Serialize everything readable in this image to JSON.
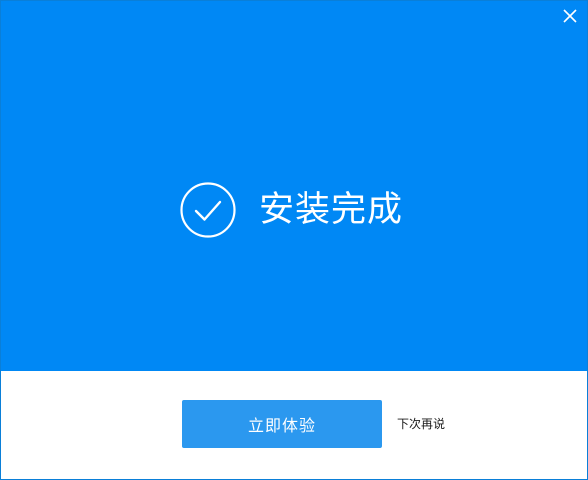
{
  "window": {
    "close_icon": "close-icon"
  },
  "status": {
    "icon": "check-circle-icon",
    "text": "安装完成"
  },
  "actions": {
    "primary_label": "立即体验",
    "secondary_label": "下次再说"
  },
  "colors": {
    "hero_bg": "#0088f5",
    "button_bg": "#2b98ef",
    "text_on_blue": "#ffffff"
  }
}
